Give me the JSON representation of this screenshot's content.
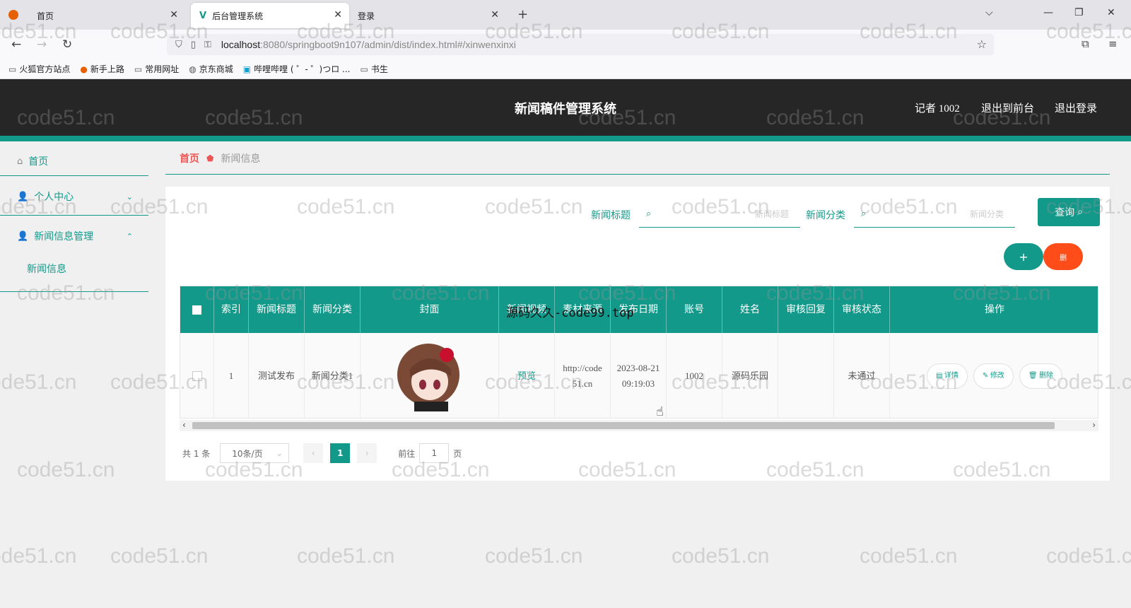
{
  "browser": {
    "tabs": [
      {
        "label": "首页",
        "active": false
      },
      {
        "label": "后台管理系统",
        "active": true
      },
      {
        "label": "登录",
        "active": false
      }
    ],
    "url_host": "localhost",
    "url_rest": ":8080/springboot9n107/admin/dist/index.html#/xinwenxinxi",
    "bookmarks": [
      "火狐官方站点",
      "新手上路",
      "常用网址",
      "京东商城",
      "哔哩哔哩 ( ゜- ゜)つロ ...",
      "书生"
    ]
  },
  "header": {
    "title": "新闻稿件管理系统",
    "user": "记者 1002",
    "to_front": "退出到前台",
    "logout": "退出登录",
    "accent": "#13998a"
  },
  "sidebar": {
    "home": "首页",
    "personal": "个人中心",
    "news_mgmt": "新闻信息管理",
    "news_info": "新闻信息"
  },
  "breadcrumb": {
    "home": "首页",
    "current": "新闻信息"
  },
  "search": {
    "title_label": "新闻标题",
    "title_placeholder": "新闻标题",
    "category_label": "新闻分类",
    "category_placeholder": "新闻分类",
    "query_button": "查询",
    "add_button": "+",
    "delete_button": "删"
  },
  "table": {
    "headers": [
      "索引",
      "新闻标题",
      "新闻分类",
      "封面",
      "新闻视频",
      "素材来源",
      "发布日期",
      "账号",
      "姓名",
      "审核回复",
      "审核状态",
      "操作"
    ],
    "rows": [
      {
        "index": "1",
        "title": "测试发布",
        "category": "新闻分类1",
        "video": "预览",
        "source": "http://code51.cn",
        "date": "2023-08-21 09:19:03",
        "account": "1002",
        "name": "源码乐园",
        "reply": "",
        "status": "未通过",
        "ops": [
          "详情",
          "修改",
          "删除"
        ]
      }
    ]
  },
  "pagination": {
    "total": "共 1 条",
    "page_size": "10条/页",
    "current_page": "1",
    "goto_label": "前往",
    "goto_value": "1",
    "page_suffix": "页"
  },
  "overlay_text": "源码久久-code99.top",
  "watermark": "code51.cn"
}
